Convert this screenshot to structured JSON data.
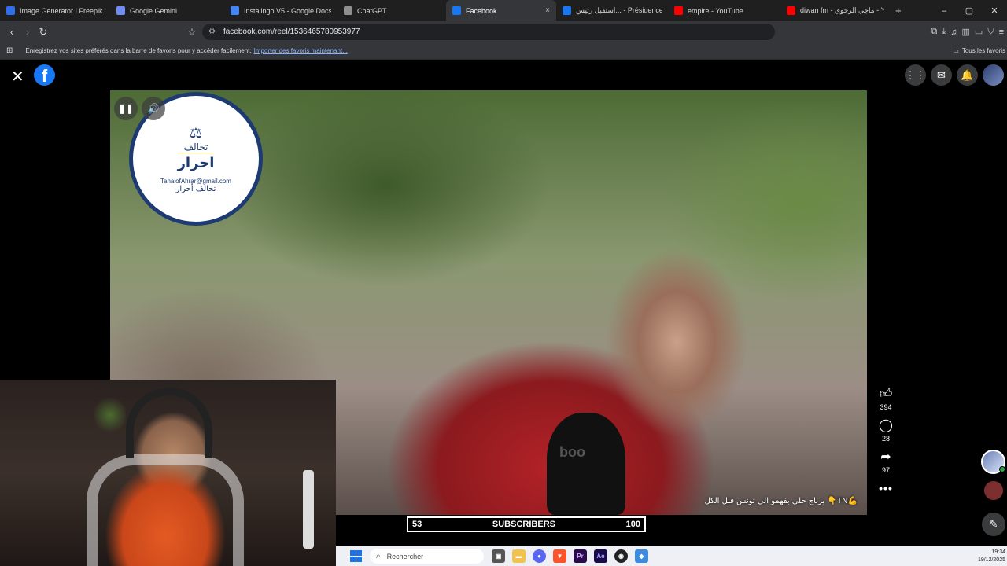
{
  "browser": {
    "tabs": [
      {
        "title": "Image Generator I Freepik AI",
        "fav_color": "#2f6feb",
        "active": false,
        "width": 140
      },
      {
        "title": "Google Gemini",
        "fav_color": "#6f8cf0",
        "active": false,
        "width": 145
      },
      {
        "title": "Instalingo V5 - Google Docs",
        "fav_color": "#4285f4",
        "active": false,
        "width": 144
      },
      {
        "title": "ChatGPT",
        "fav_color": "#8e8e8e",
        "active": false,
        "width": 138
      },
      {
        "title": "Facebook",
        "fav_color": "#1877f2",
        "active": true,
        "width": 140
      },
      {
        "title": "استقبل رئيس... - Présidence Tunisie",
        "fav_color": "#1877f2",
        "active": false,
        "width": 142
      },
      {
        "title": "empire - YouTube",
        "fav_color": "#ff0000",
        "active": false,
        "width": 143
      },
      {
        "title": "diwan fm - ماجي الرحوي - YouTube",
        "fav_color": "#ff0000",
        "active": false,
        "width": 140
      }
    ],
    "active_tab_close": "×",
    "new_tab": "+",
    "url": "facebook.com/reel/1536465780953977",
    "bookmarks_prompt": "Enregistrez vos sites préférés dans la barre de favoris pour y accéder facilement.",
    "bookmarks_link": "Importer des favoris maintenant...",
    "all_bookmarks": "Tous les favoris"
  },
  "video": {
    "logo_line1": "تحالف",
    "logo_line2": "احرار",
    "logo_email": "TahalofAhrar@gmail.com",
    "logo_line3": "تحالف أحرار",
    "mic_brand": "boo",
    "caption": "برناج حلي يفهمو الي تونس قبل الكل 👇TN💪"
  },
  "reel_actions": {
    "likes": "394",
    "comments": "28",
    "shares": "97"
  },
  "stream_overlay": {
    "subscribers_current": "53",
    "subscribers_label": "SUBSCRIBERS",
    "subscribers_goal": "100"
  },
  "taskbar": {
    "search_placeholder": "Rechercher",
    "time": "19:34",
    "date": "19/12/2025"
  }
}
